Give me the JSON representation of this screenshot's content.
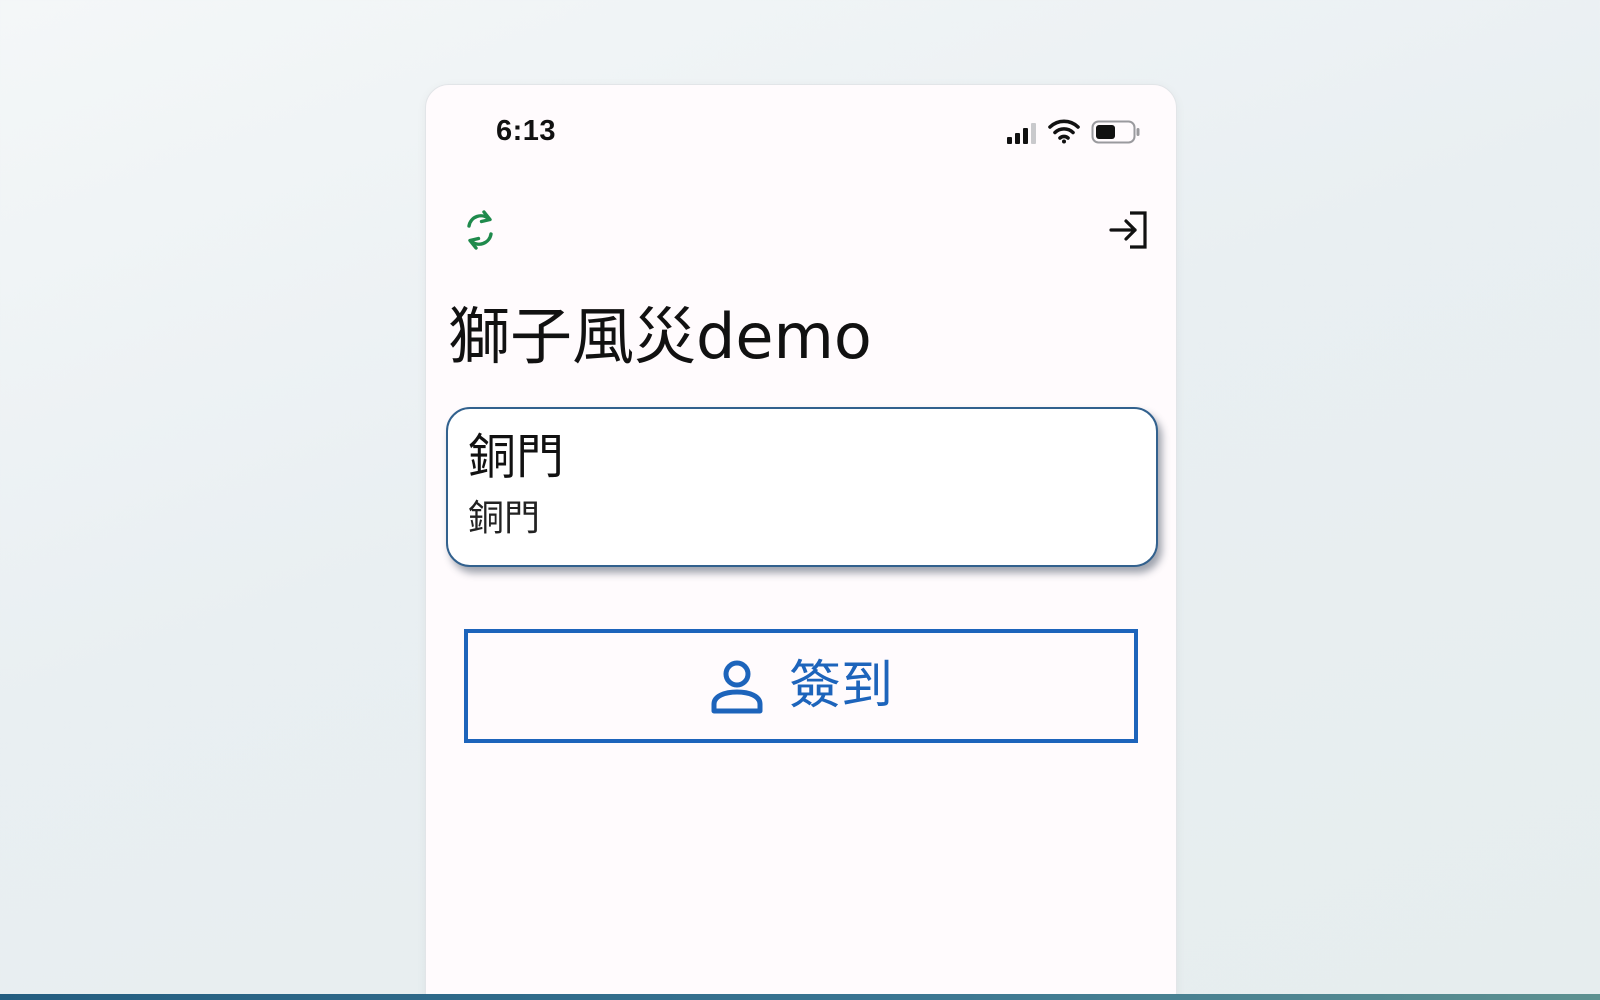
{
  "status_bar": {
    "time": "6:13"
  },
  "icons": {
    "refresh": "refresh-icon",
    "logout": "logout-icon",
    "person": "person-icon",
    "signal": "signal-icon",
    "wifi": "wifi-icon",
    "battery": "battery-icon"
  },
  "header": {
    "title": "獅子風災demo"
  },
  "location_card": {
    "title": "銅門",
    "subtitle": "銅門"
  },
  "checkin_button": {
    "label": "簽到"
  },
  "colors": {
    "refresh_green": "#1f8a4c",
    "card_border": "#32618e",
    "button_blue": "#1d64bb",
    "app_background": "#fffbfd"
  }
}
